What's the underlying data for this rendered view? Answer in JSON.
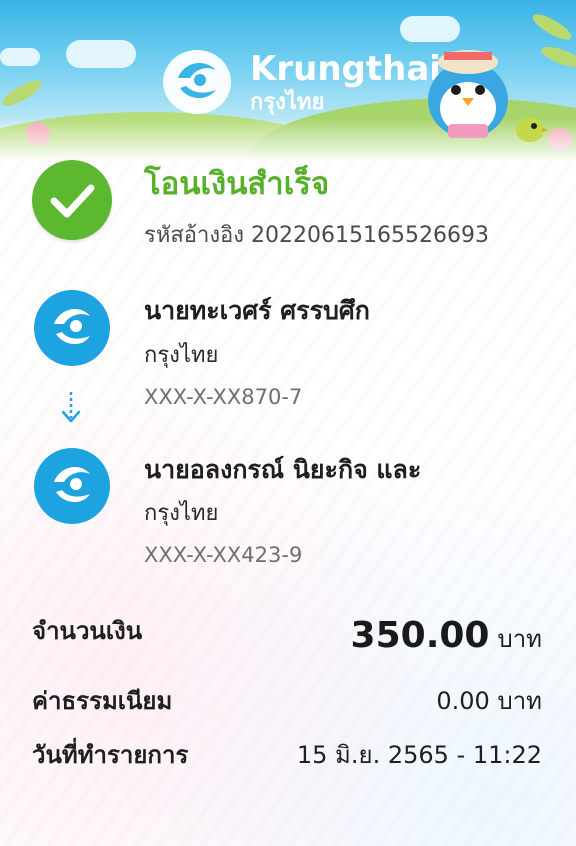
{
  "header": {
    "brand_en": "Krungthai",
    "brand_th": "กรุงไทย",
    "colors": {
      "sky": "#3ab4e6",
      "hill": "#a7d46b"
    }
  },
  "status": {
    "title": "โอนเงินสำเร็จ",
    "reference": "รหัสอ้างอิง 20220615165526693",
    "icon": "check-icon",
    "color": "#5cb82f"
  },
  "sender": {
    "name": "นายทะเวศร์ ศรรบศึก",
    "bank": "กรุงไทย",
    "account": "XXX-X-XX870-7",
    "icon": "krungthai-logo-icon"
  },
  "receiver": {
    "name": "นายอลงกรณ์ นิยะกิจ และ",
    "bank": "กรุงไทย",
    "account": "XXX-X-XX423-9",
    "icon": "krungthai-logo-icon"
  },
  "summary": {
    "amount_label": "จำนวนเงิน",
    "amount_value": "350.00",
    "amount_unit": "บาท",
    "fee_label": "ค่าธรรมเนียม",
    "fee_value": "0.00 บาท",
    "date_label": "วันที่ทำรายการ",
    "date_value": "15 มิ.ย. 2565 - 11:22"
  },
  "accent_blue": "#1da3e0"
}
